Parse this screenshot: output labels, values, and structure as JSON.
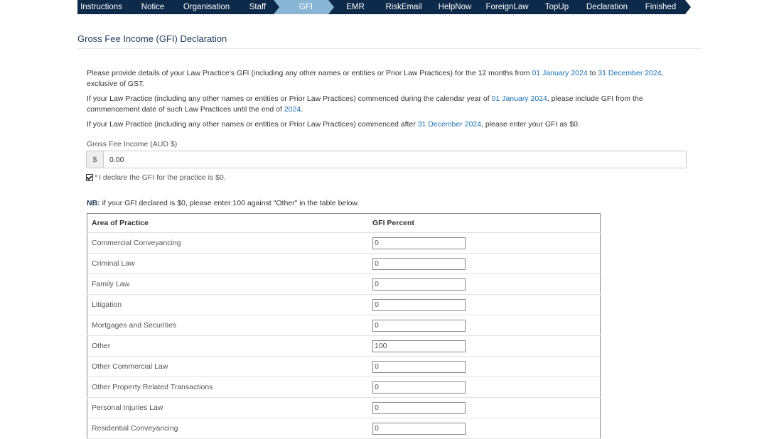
{
  "wizard": {
    "steps": [
      "Instructions",
      "Notice",
      "Organisation",
      "Staff",
      "GFI",
      "EMR",
      "RiskEmail",
      "HelpNow",
      "ForeignLaw",
      "TopUp",
      "Declaration",
      "Finished"
    ],
    "active_index": 4,
    "colors": {
      "step": "#0d2a4a",
      "active": "#8ab6d6",
      "text": "#ffffff"
    }
  },
  "page_title": "Gross Fee Income (GFI) Declaration",
  "intro": {
    "p1": {
      "a": "Please provide details of your Law Practice's GFI (including any other names or entities or Prior Law Practices) for the 12 months from ",
      "d1": "01 January 2024",
      "b": " to ",
      "d2": "31 December 2024",
      "c": ", exclusive of GST."
    },
    "p2": {
      "a": "If your Law Practice (including any other names or entities or Prior Law Practices) commenced during the calendar year of ",
      "d1": "01 January 2024",
      "b": ", please include GFI from the commencement date of such Law Practices until the end of ",
      "d2": "2024",
      "c": "."
    },
    "p3": {
      "a": "If your Law Practice (including any other names or entities or Prior Law Practices) commenced after ",
      "d1": "31 December 2024",
      "b": ", please enter your GFI as $0."
    }
  },
  "gfi_field": {
    "label": "Gross Fee Income (AUD $)",
    "addon": "$",
    "value": "0.00"
  },
  "declare": {
    "required_mark": "*",
    "label": "I declare the GFI for the practice is $0.",
    "checked": true
  },
  "nb": {
    "prefix": "NB:",
    "text": " if your GFI declared is $0, please enter 100 against \"Other\" in the table below."
  },
  "table": {
    "headers": {
      "area": "Area of Practice",
      "pct": "GFI Percent"
    },
    "rows": [
      {
        "area": "Commercial Conveyancing",
        "pct": "0"
      },
      {
        "area": "Criminal Law",
        "pct": "0"
      },
      {
        "area": "Family Law",
        "pct": "0"
      },
      {
        "area": "Litigation",
        "pct": "0"
      },
      {
        "area": "Mortgages and Securities",
        "pct": "0"
      },
      {
        "area": "Other",
        "pct": "100"
      },
      {
        "area": "Other Commercial Law",
        "pct": "0"
      },
      {
        "area": "Other Property Related Transactions",
        "pct": "0"
      },
      {
        "area": "Personal Injuries Law",
        "pct": "0"
      },
      {
        "area": "Residential Conveyancing",
        "pct": "0"
      }
    ]
  }
}
